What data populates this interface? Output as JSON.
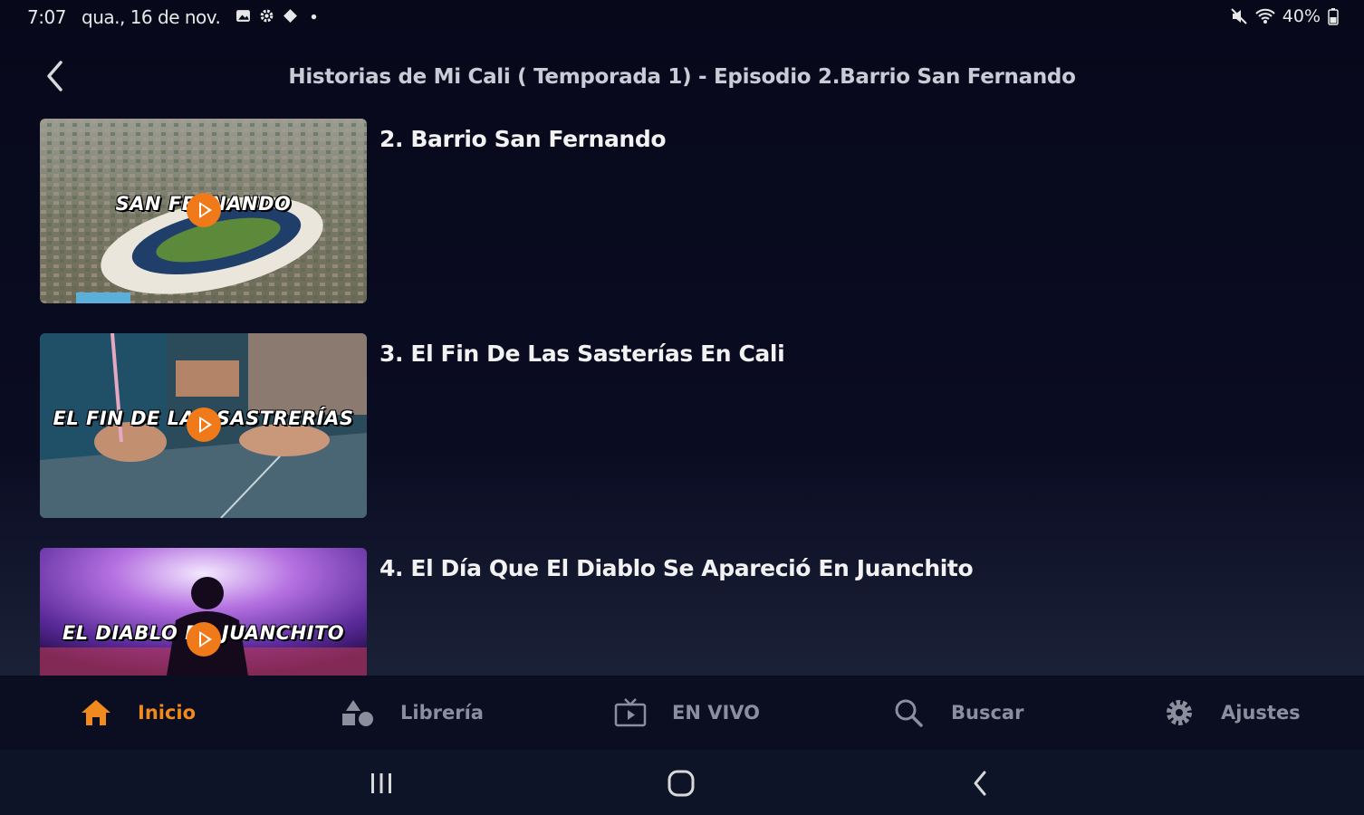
{
  "status_bar": {
    "time": "7:07",
    "date": "qua., 16 de nov.",
    "battery": "40%"
  },
  "header": {
    "title": "Historias de Mi Cali ( Temporada 1) - Episodio 2.Barrio San Fernando"
  },
  "episodes": [
    {
      "title": "2. Barrio San Fernando",
      "thumb_text": "SAN FERNANDO"
    },
    {
      "title": "3. El Fin De Las Sasterías En Cali",
      "thumb_text": "EL FIN DE LAS SASTRERÍAS"
    },
    {
      "title": "4. El Día Que El Diablo Se Apareció En Juanchito",
      "thumb_text": "EL DIABLO EN JUANCHITO"
    }
  ],
  "bottom_nav": [
    {
      "label": "Inicio",
      "icon": "home-icon",
      "active": true
    },
    {
      "label": "Librería",
      "icon": "library-icon",
      "active": false
    },
    {
      "label": "EN VIVO",
      "icon": "live-tv-icon",
      "active": false
    },
    {
      "label": "Buscar",
      "icon": "search-icon",
      "active": false
    },
    {
      "label": "Ajustes",
      "icon": "gear-icon",
      "active": false
    }
  ],
  "colors": {
    "accent": "#f08a1e",
    "background": "#07081a",
    "nav_inactive": "#8a8f9e"
  }
}
